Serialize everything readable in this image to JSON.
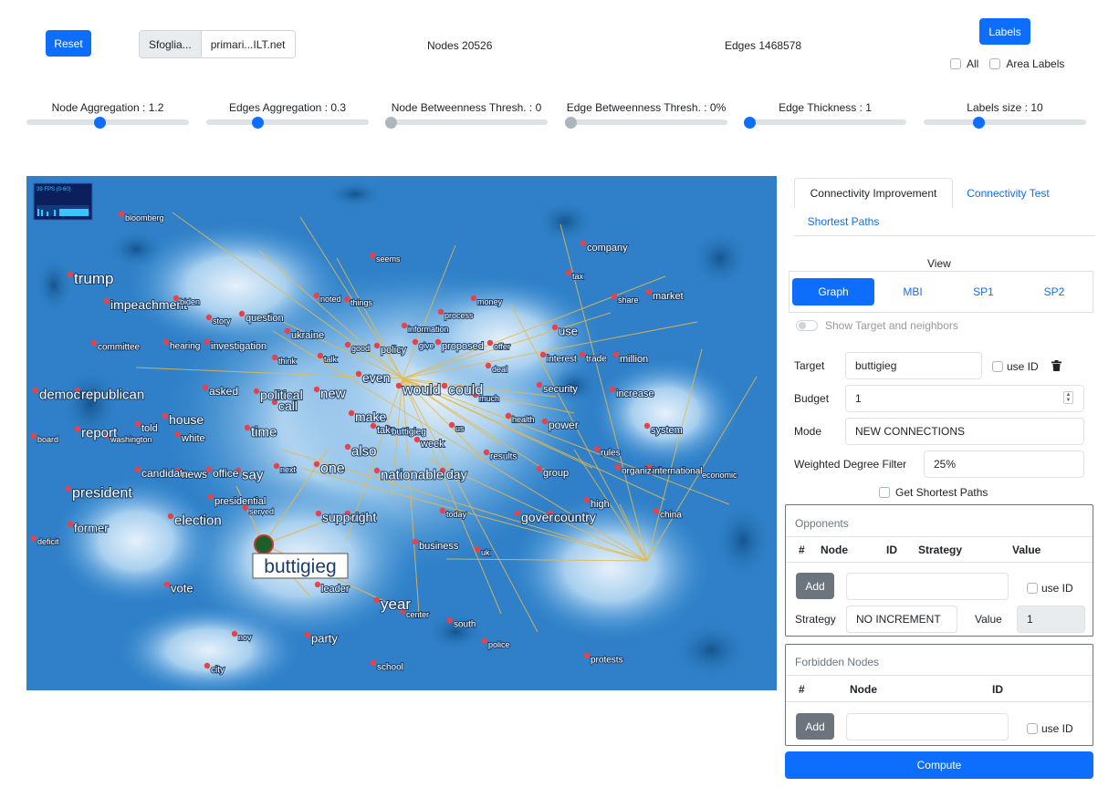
{
  "toolbar": {
    "reset_label": "Reset",
    "browse_label": "Sfoglia...",
    "file_name": "primari...ILT.net",
    "nodes_text": "Nodes 20526",
    "edges_text": "Edges 1468578",
    "labels_label": "Labels",
    "all_label": "All",
    "area_labels_label": "Area Labels"
  },
  "sliders": [
    {
      "label": "Node Aggregation : 1.2",
      "fraction": 0.45,
      "active": true
    },
    {
      "label": "Edges Aggregation : 0.3",
      "fraction": 0.3,
      "active": true
    },
    {
      "label": "Node Betweenness Thresh. : 0",
      "fraction": 0.0,
      "active": false
    },
    {
      "label": "Edge Betweenness Thresh. : 0%",
      "fraction": 0.0,
      "active": false
    },
    {
      "label": "Edge Thickness : 1",
      "fraction": 0.0,
      "active": true
    },
    {
      "label": "Labels size : 10",
      "fraction": 0.33,
      "active": true
    }
  ],
  "graph": {
    "fps": "39 FPS (0-60)",
    "labels": [
      "bloomberg",
      "health",
      "company",
      "seems",
      "trump",
      "tax",
      "impeachment",
      "biden",
      "noted",
      "things",
      "money",
      "share",
      "market",
      "story",
      "question",
      "process",
      "ukraine",
      "information",
      "use",
      "committee",
      "hearing",
      "investigation",
      "think",
      "talk",
      "good",
      "policy",
      "give",
      "proposed",
      "offer",
      "interest",
      "trade",
      "million",
      "deal",
      "even",
      "security",
      "democrat",
      "republican",
      "asked",
      "political",
      "call",
      "new",
      "would",
      "could",
      "much",
      "increase",
      "house",
      "make",
      "take",
      "us",
      "health",
      "power",
      "system",
      "board",
      "report",
      "told",
      "washington",
      "white",
      "time",
      "week",
      "also",
      "results",
      "rules",
      "organization",
      "international",
      "economic",
      "candidate",
      "news",
      "office",
      "say",
      "next",
      "one",
      "nationable",
      "day",
      "group",
      "president",
      "presidential",
      "served",
      "support",
      "right",
      "today",
      "government",
      "country",
      "high",
      "china",
      "former",
      "election",
      "business",
      "uk",
      "deficit",
      "buttigieg",
      "vote",
      "leader",
      "year",
      "center",
      "south",
      "nov",
      "party",
      "police",
      "city",
      "school",
      "protests"
    ],
    "focus_label": "buttigieg"
  },
  "panel": {
    "tabs": [
      "Connectivity Improvement",
      "Connectivity Test",
      "Shortest Paths"
    ],
    "view_label": "View",
    "view_tabs": [
      "Graph",
      "MBI",
      "SP1",
      "SP2"
    ],
    "show_target_label": "Show Target and neighbors",
    "target_label": "Target",
    "target_value": "buttigieg",
    "use_id_label": "use ID",
    "budget_label": "Budget",
    "budget_value": "1",
    "mode_label": "Mode",
    "mode_value": "NEW CONNECTIONS",
    "wdf_label": "Weighted Degree Filter",
    "wdf_value": "25%",
    "get_sp_label": "Get Shortest Paths",
    "opponents_title": "Opponents",
    "opp_headers": [
      "#",
      "Node",
      "ID",
      "Strategy",
      "Value"
    ],
    "add_label": "Add",
    "strategy_label": "Strategy",
    "strategy_value": "NO INCREMENT",
    "value_label": "Value",
    "value_value": "1",
    "forbidden_title": "Forbidden Nodes",
    "forb_headers": [
      "#",
      "Node",
      "ID"
    ],
    "compute_label": "Compute"
  },
  "colors": {
    "primary": "#0d6efd",
    "node": "#e8414a",
    "edge": "#e6b84a",
    "focus_node": "#1e5e2a"
  }
}
